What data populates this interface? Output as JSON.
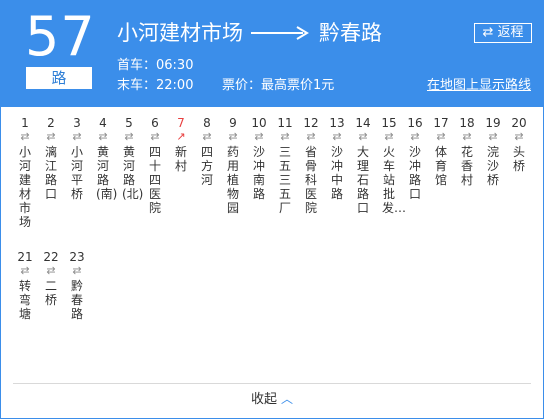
{
  "route": {
    "number": "57",
    "suffix": "路",
    "origin": "小河建材市场",
    "destination": "黔春路",
    "reverse_label": "返程",
    "first_bus": "首车：06:30",
    "last_bus": "末车：22:00",
    "fare": "票价：最高票价1元",
    "map_link": "在地图上显示路线"
  },
  "stops": [
    {
      "num": "1",
      "name": "小河建材市场"
    },
    {
      "num": "2",
      "name": "漓江路口"
    },
    {
      "num": "3",
      "name": "小河平桥"
    },
    {
      "num": "4",
      "name": "黄河路(南)"
    },
    {
      "num": "5",
      "name": "黄河路(北)"
    },
    {
      "num": "6",
      "name": "四十四医院"
    },
    {
      "num": "7",
      "name": "新村",
      "current": true
    },
    {
      "num": "8",
      "name": "四方河"
    },
    {
      "num": "9",
      "name": "药用植物园"
    },
    {
      "num": "10",
      "name": "沙冲南路"
    },
    {
      "num": "11",
      "name": "三五三五厂"
    },
    {
      "num": "12",
      "name": "省骨科医院"
    },
    {
      "num": "13",
      "name": "沙冲中路"
    },
    {
      "num": "14",
      "name": "大理石路口"
    },
    {
      "num": "15",
      "name": "火车站批发…"
    },
    {
      "num": "16",
      "name": "沙冲路口"
    },
    {
      "num": "17",
      "name": "体育馆"
    },
    {
      "num": "18",
      "name": "花香村"
    },
    {
      "num": "19",
      "name": "浣沙桥"
    },
    {
      "num": "20",
      "name": "头桥"
    },
    {
      "num": "21",
      "name": "转弯塘"
    },
    {
      "num": "22",
      "name": "二桥"
    },
    {
      "num": "23",
      "name": "黔春路"
    }
  ],
  "collapse_label": "收起",
  "colors": {
    "accent": "#3b8eea",
    "current": "#e84040"
  }
}
